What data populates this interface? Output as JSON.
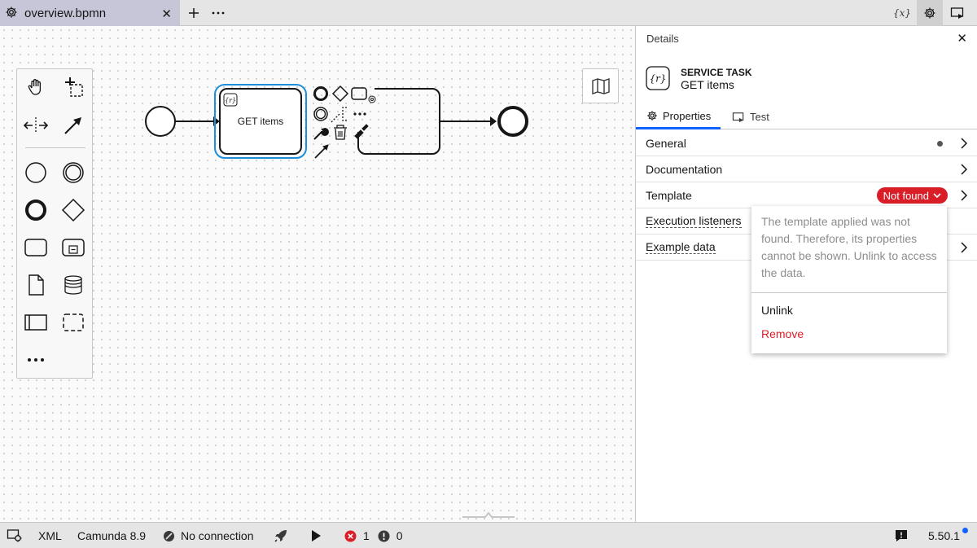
{
  "tab": {
    "title": "overview.bpmn"
  },
  "toolbar": {
    "variables_label": "{x}"
  },
  "palette": {
    "tools": [
      "hand-tool",
      "lasso-tool",
      "space-tool",
      "global-connect-tool"
    ],
    "elements": [
      "start-event",
      "intermediate-event",
      "end-event",
      "gateway",
      "task",
      "subprocess",
      "data-object",
      "data-store",
      "pool",
      "group"
    ],
    "more": "..."
  },
  "diagram": {
    "task_label": "GET items",
    "task_marker": "{r}"
  },
  "panel": {
    "title": "Details",
    "element_type": "SERVICE TASK",
    "element_name": "GET items",
    "element_icon_text": "{r}",
    "tabs": [
      {
        "label": "Properties"
      },
      {
        "label": "Test"
      }
    ],
    "groups": [
      {
        "label": "General"
      },
      {
        "label": "Documentation"
      },
      {
        "label": "Template"
      },
      {
        "label": "Execution listeners"
      },
      {
        "label": "Example data"
      }
    ],
    "template_badge": "Not found"
  },
  "popup": {
    "message": "The template applied was not found. Therefore, its properties cannot be shown. Unlink to access the data.",
    "unlink": "Unlink",
    "remove": "Remove"
  },
  "statusbar": {
    "xml": "XML",
    "engine": "Camunda 8.9",
    "connection": "No connection",
    "errors": "1",
    "warnings": "0",
    "version": "5.50.1"
  },
  "colors": {
    "accent": "#0f62fe",
    "error": "#da1e28",
    "selection": "#1c8fda"
  }
}
